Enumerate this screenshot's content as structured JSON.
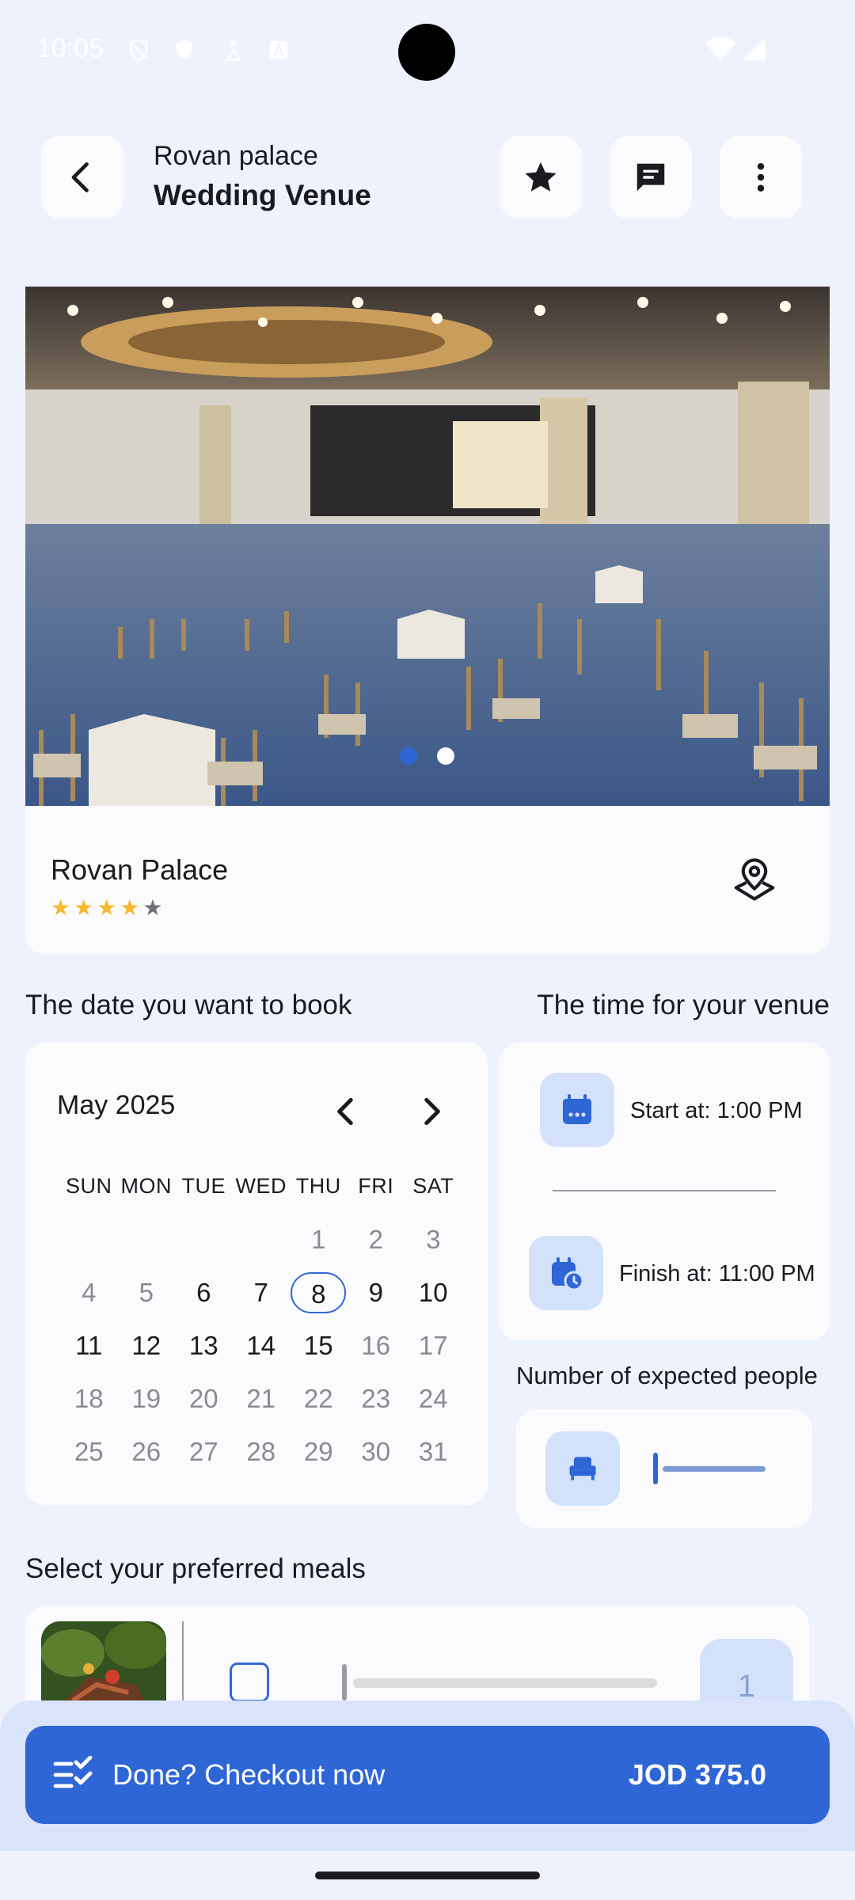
{
  "status_bar": {
    "time": "10:05"
  },
  "top_bar": {
    "subtitle": "Rovan palace",
    "title": "Wedding Venue"
  },
  "venue": {
    "name": "Rovan Palace",
    "stars": "★★★★",
    "star_empty": "★",
    "rating": 4
  },
  "carousel": {
    "current_page": 1,
    "total_pages": 2
  },
  "labels": {
    "date_section": "The date you want to book",
    "time_section": "The time for your venue",
    "people_section": "Number of expected people",
    "meals_section": "Select your preferred meals"
  },
  "calendar": {
    "month": "May 2025",
    "weekdays": [
      "SUN",
      "MON",
      "TUE",
      "WED",
      "THU",
      "FRI",
      "SAT"
    ],
    "selected_day": "8",
    "weeks": [
      [
        "",
        "",
        "",
        "",
        "1",
        "2",
        "3"
      ],
      [
        "4",
        "5",
        "6",
        "7",
        "8",
        "9",
        "10"
      ],
      [
        "11",
        "12",
        "13",
        "14",
        "15",
        "16",
        "17"
      ],
      [
        "18",
        "19",
        "20",
        "21",
        "22",
        "23",
        "24"
      ],
      [
        "25",
        "26",
        "27",
        "28",
        "29",
        "30",
        "31"
      ]
    ],
    "enabled_days": [
      "6",
      "7",
      "8",
      "9",
      "10",
      "11",
      "12",
      "13",
      "14",
      "15"
    ]
  },
  "time": {
    "start": "Start at: 1:00 PM",
    "finish": "Finish at: 11:00 PM"
  },
  "people": {
    "slider_value": 0
  },
  "meal": {
    "quantity": "1",
    "checked": false
  },
  "checkout": {
    "label": "Done? Checkout now",
    "price": "JOD 375.0"
  },
  "colors": {
    "accent": "#2f66d6",
    "icon_bg": "#d4e1fb",
    "star": "#f5b82e",
    "background": "#eef2fc"
  }
}
